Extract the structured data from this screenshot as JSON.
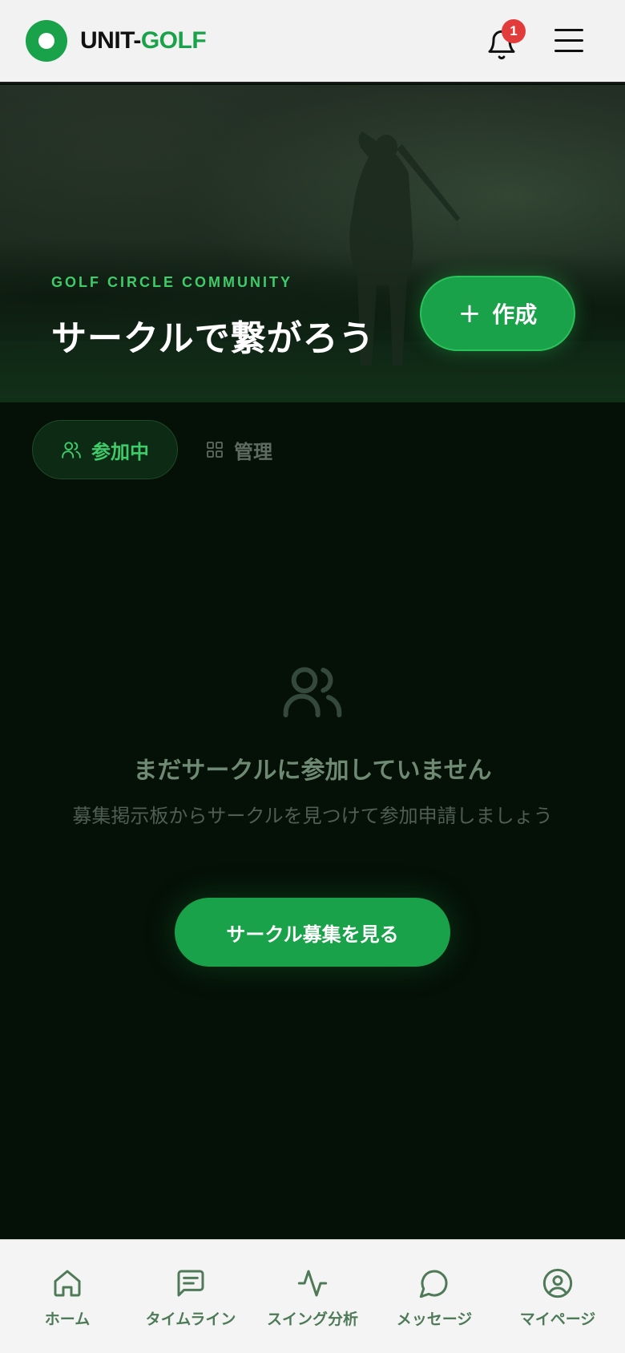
{
  "header": {
    "logo_text_primary": "UNIT-",
    "logo_text_accent": "GOLF",
    "notification_count": "1"
  },
  "hero": {
    "eyebrow": "GOLF CIRCLE COMMUNITY",
    "title": "サークルで繋がろう",
    "create_label": "作成"
  },
  "tabs": {
    "joined_label": "参加中",
    "manage_label": "管理",
    "active": "joined"
  },
  "empty_state": {
    "title": "まだサークルに参加していません",
    "description": "募集掲示板からサークルを見つけて参加申請しましょう",
    "button_label": "サークル募集を見る"
  },
  "bottom_nav": {
    "items": [
      {
        "label": "ホーム",
        "icon": "home-icon"
      },
      {
        "label": "タイムライン",
        "icon": "message-square-icon"
      },
      {
        "label": "スイング分析",
        "icon": "activity-icon"
      },
      {
        "label": "メッセージ",
        "icon": "chat-bubble-icon"
      },
      {
        "label": "マイページ",
        "icon": "user-circle-icon"
      }
    ]
  },
  "colors": {
    "brand_green": "#1aa24a",
    "accent_green": "#3fcb6a",
    "badge_red": "#e23b3b",
    "background": "#051007"
  }
}
